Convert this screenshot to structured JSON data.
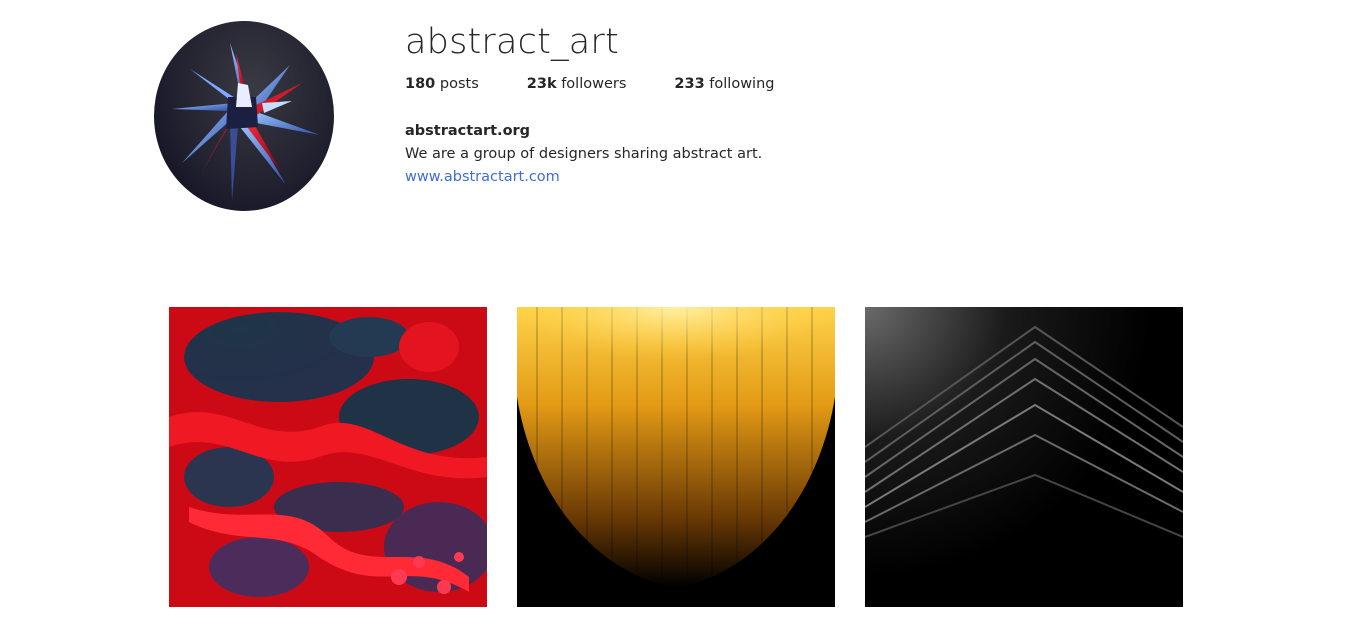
{
  "profile": {
    "username": "abstract_art",
    "stats": {
      "posts_count": "180",
      "posts_label": " posts",
      "followers_count": "23k",
      "followers_label": " followers",
      "following_count": "233",
      "following_label": " following"
    },
    "bio": {
      "name": "abstractart.org",
      "text": "We are a group of designers sharing abstract art.",
      "website": "www.abstractart.com"
    },
    "avatar_icon": "abstract-star-avatar"
  },
  "posts": [
    {
      "icon": "red-fluid-art-image",
      "colors": [
        "#e0101c",
        "#1f3246"
      ]
    },
    {
      "icon": "golden-light-streaks-image",
      "colors": [
        "#f2a81e",
        "#000000"
      ]
    },
    {
      "icon": "dark-chevron-building-image",
      "colors": [
        "#4a4a4a",
        "#000000"
      ]
    }
  ],
  "colors": {
    "link": "#3f6ed3",
    "text": "#262626"
  }
}
